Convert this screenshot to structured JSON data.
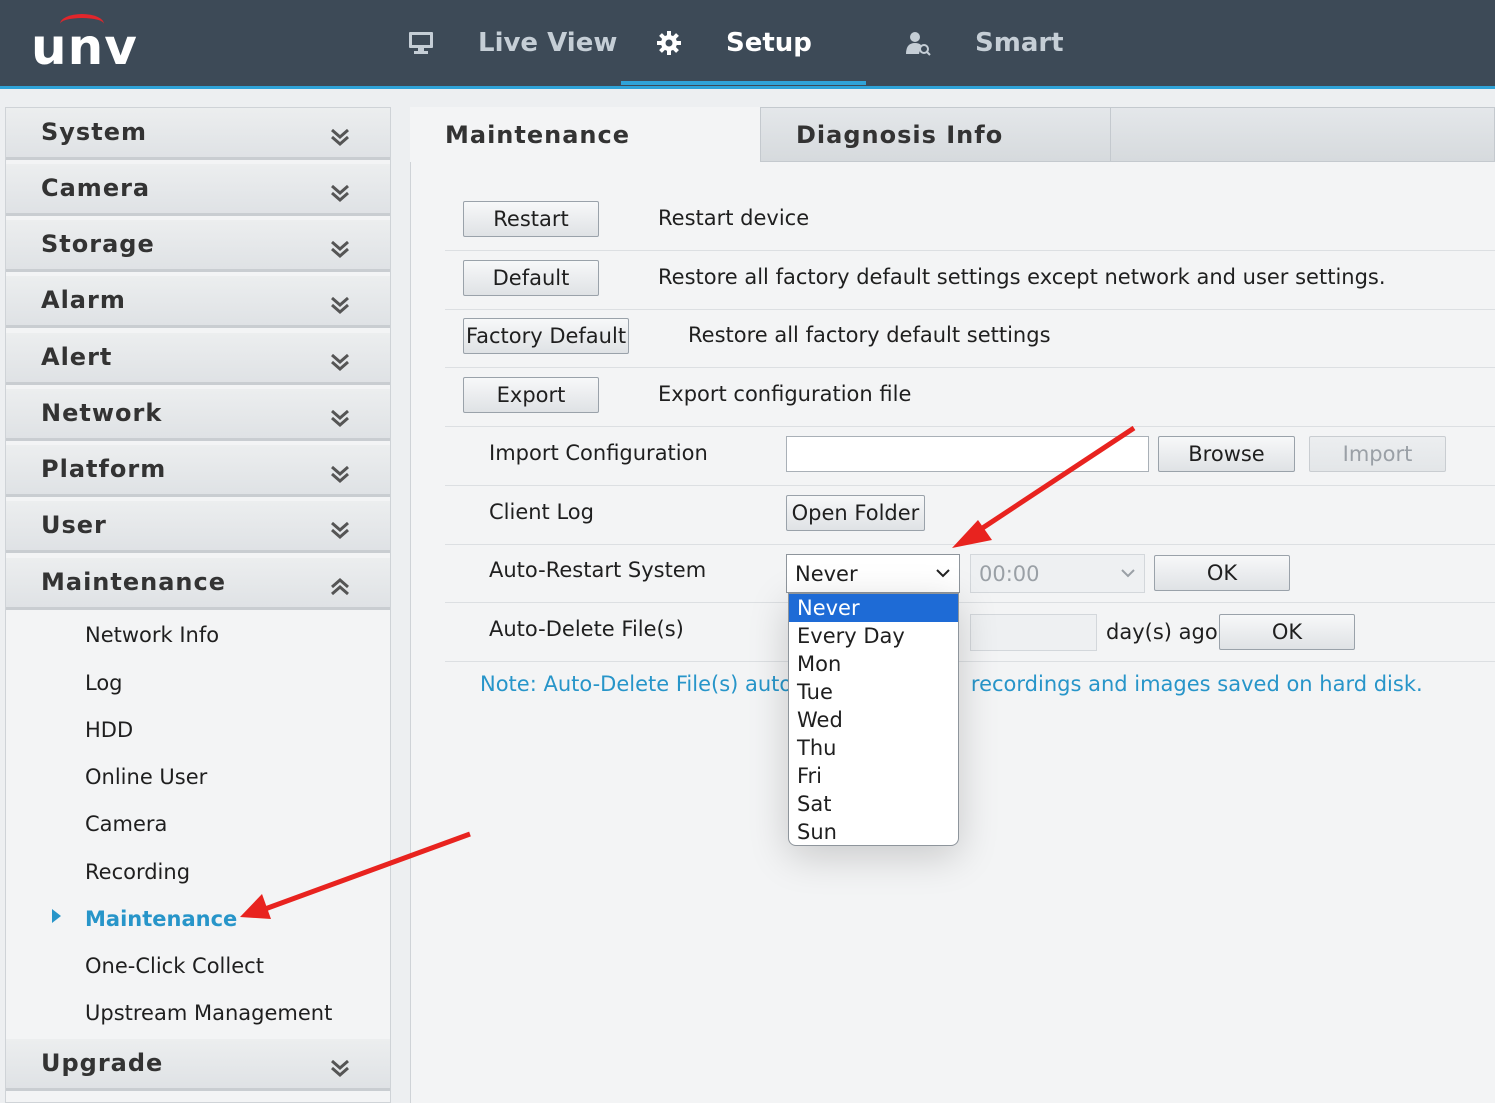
{
  "header": {
    "logo_text": "unv",
    "nav": [
      {
        "label": "Live View",
        "icon": "monitor-icon"
      },
      {
        "label": "Setup",
        "icon": "gear-icon"
      },
      {
        "label": "Smart",
        "icon": "person-search-icon"
      }
    ],
    "active_nav": "Setup"
  },
  "sidebar": {
    "sections": [
      "System",
      "Camera",
      "Storage",
      "Alarm",
      "Alert",
      "Network",
      "Platform",
      "User",
      "Maintenance"
    ],
    "maintenance_items": [
      "Network Info",
      "Log",
      "HDD",
      "Online User",
      "Camera",
      "Recording",
      "Maintenance",
      "One-Click Collect",
      "Upstream Management"
    ],
    "active_item": "Maintenance",
    "upgrade_label": "Upgrade"
  },
  "tabs": {
    "maintenance": "Maintenance",
    "diagnosis": "Diagnosis Info"
  },
  "actions": {
    "restart_btn": "Restart",
    "restart_desc": "Restart device",
    "default_btn": "Default",
    "default_desc": "Restore all factory default settings except network and user settings.",
    "factory_btn": "Factory Default",
    "factory_desc": "Restore all factory default settings",
    "export_btn": "Export",
    "export_desc": "Export configuration file"
  },
  "import_config": {
    "label": "Import Configuration",
    "value": "",
    "browse_btn": "Browse",
    "import_btn": "Import"
  },
  "client_log": {
    "label": "Client Log",
    "open_btn": "Open Folder"
  },
  "auto_restart": {
    "label": "Auto-Restart System",
    "selected": "Never",
    "time": "00:00",
    "ok_btn": "OK",
    "options": [
      "Never",
      "Every Day",
      "Mon",
      "Tue",
      "Wed",
      "Thu",
      "Fri",
      "Sat",
      "Sun"
    ]
  },
  "auto_delete": {
    "label": "Auto-Delete File(s)",
    "days_value": "",
    "suffix": "day(s) ago",
    "ok_btn": "OK"
  },
  "note_left": "Note: Auto-Delete File(s) autor",
  "note_right": "recordings and images saved on hard disk.",
  "colors": {
    "header_bg": "#3d4a57",
    "accent": "#2fa3d8",
    "link_blue": "#2795c9",
    "dropdown_selected": "#1e6bd6",
    "annotation_arrow": "#e8231f"
  }
}
